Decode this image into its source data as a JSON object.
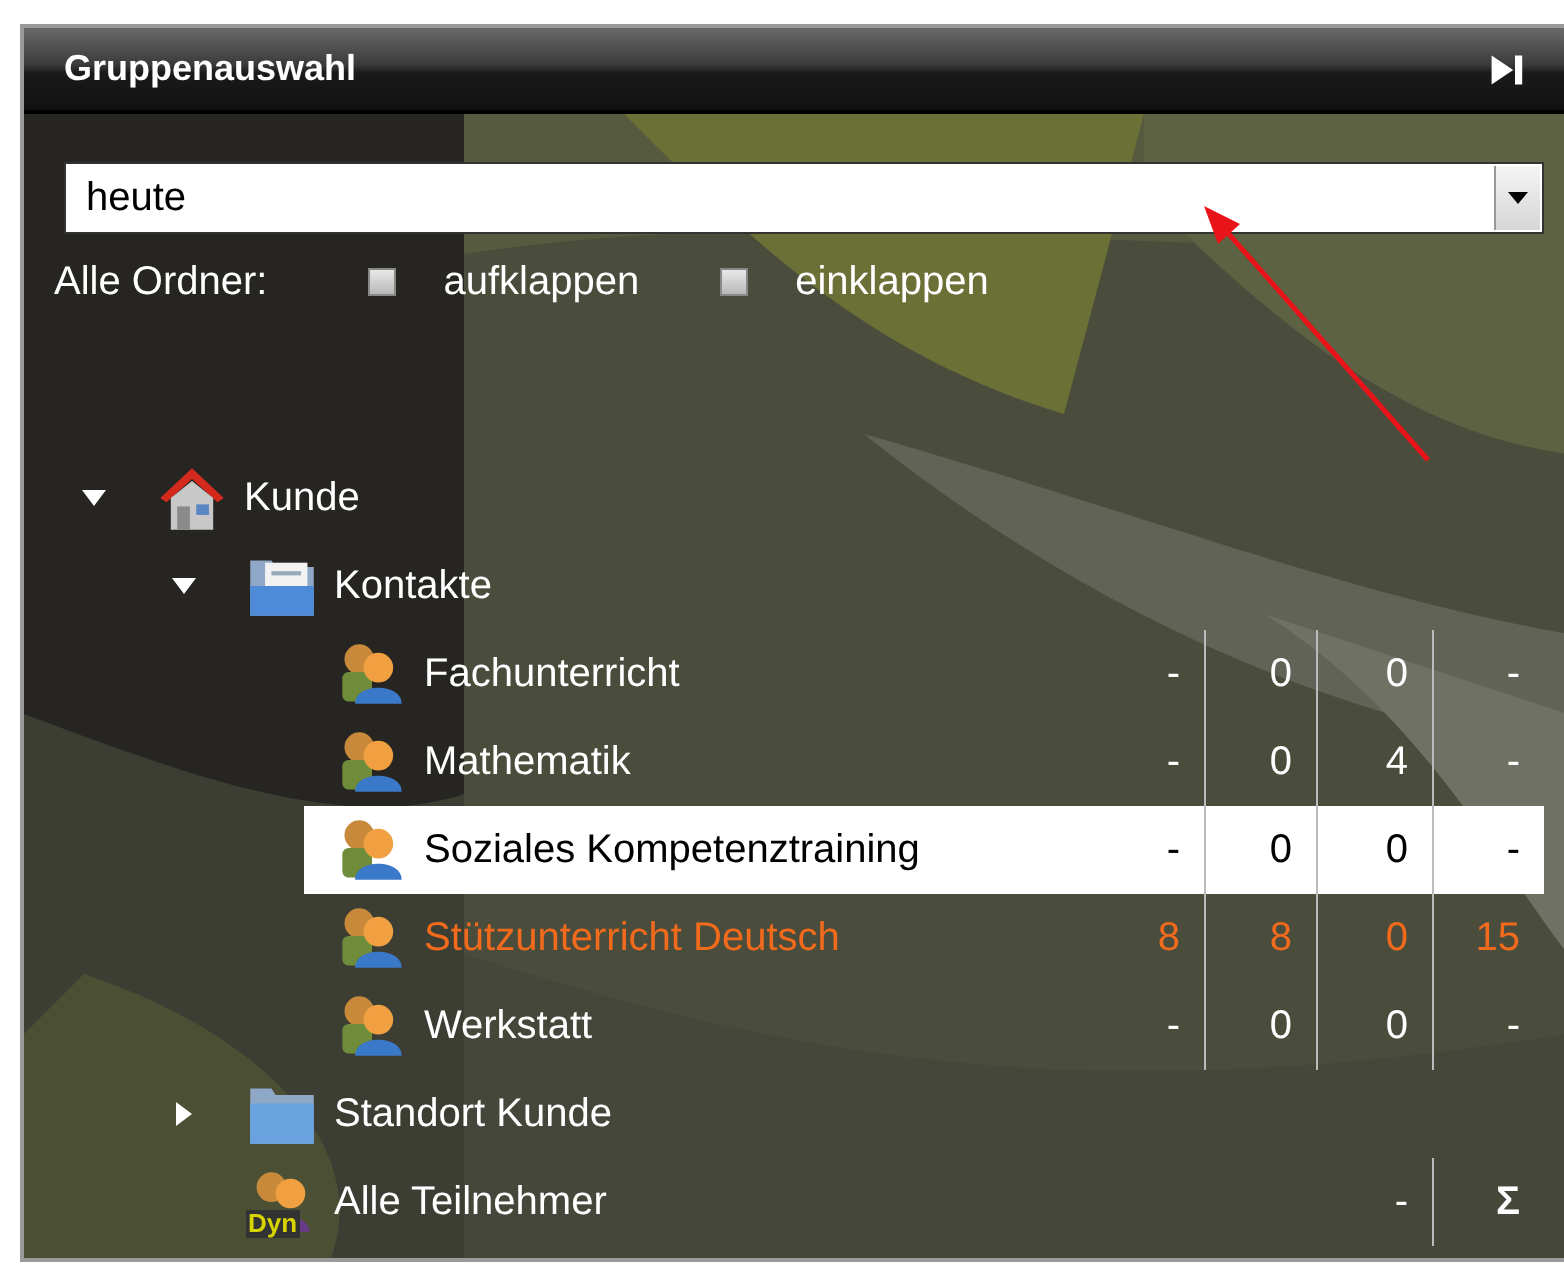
{
  "panel": {
    "title": "Gruppenauswahl"
  },
  "filter": {
    "value": "heute"
  },
  "folder_options": {
    "label": "Alle Ordner:",
    "options": [
      {
        "label": "aufklappen",
        "checked": false
      },
      {
        "label": "einklappen",
        "checked": false
      }
    ]
  },
  "tree": [
    {
      "label": "Kunde",
      "kind": "house",
      "expanded": true,
      "children": [
        {
          "label": "Kontakte",
          "kind": "folder-doc",
          "expanded": true,
          "children": [
            {
              "label": "Fachunterricht",
              "kind": "group",
              "selected": false,
              "highlighted": false,
              "counts": [
                "-",
                "0",
                "0",
                "-"
              ]
            },
            {
              "label": "Mathematik",
              "kind": "group",
              "selected": false,
              "highlighted": false,
              "counts": [
                "-",
                "0",
                "4",
                "-"
              ]
            },
            {
              "label": "Soziales Kompetenztraining",
              "kind": "group",
              "selected": true,
              "highlighted": false,
              "counts": [
                "-",
                "0",
                "0",
                "-"
              ]
            },
            {
              "label": "Stützunterricht Deutsch",
              "kind": "group",
              "selected": false,
              "highlighted": true,
              "counts": [
                "8",
                "8",
                "0",
                "15"
              ]
            },
            {
              "label": "Werkstatt",
              "kind": "group",
              "selected": false,
              "highlighted": false,
              "counts": [
                "-",
                "0",
                "0",
                "-"
              ]
            }
          ]
        },
        {
          "label": "Standort Kunde",
          "kind": "folder",
          "expanded": false
        },
        {
          "label": "Alle Teilnehmer",
          "kind": "dynamic",
          "badge": "Dyn",
          "summary": [
            "-",
            "Σ"
          ]
        }
      ]
    }
  ]
}
